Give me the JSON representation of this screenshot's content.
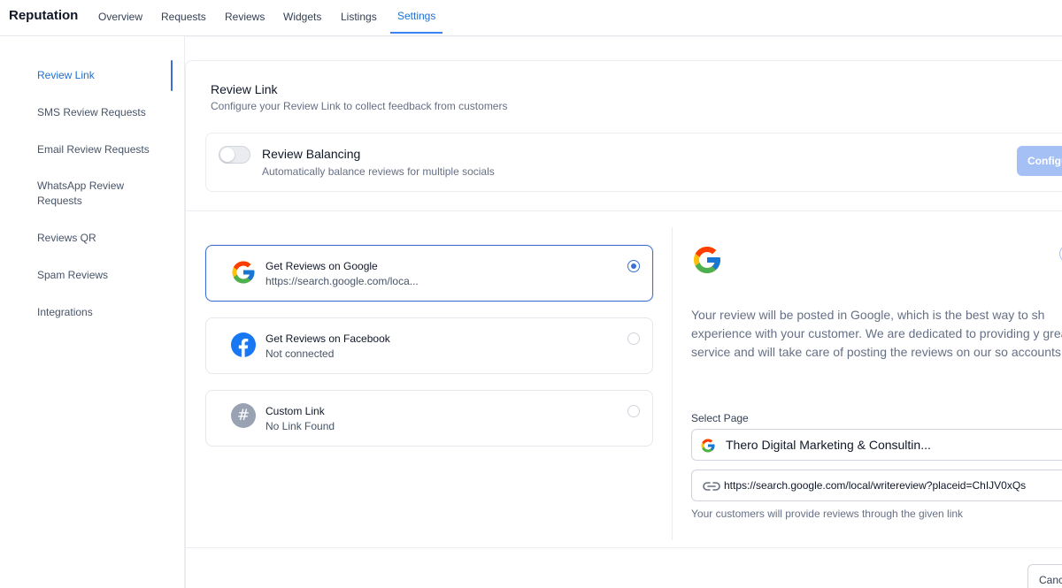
{
  "nav": {
    "brand": "Reputation",
    "tabs": [
      {
        "label": "Overview"
      },
      {
        "label": "Requests"
      },
      {
        "label": "Reviews"
      },
      {
        "label": "Widgets"
      },
      {
        "label": "Listings"
      },
      {
        "label": "Settings",
        "active": true
      }
    ]
  },
  "sidebar": {
    "items": [
      {
        "label": "Review Link",
        "active": true
      },
      {
        "label": "SMS Review Requests"
      },
      {
        "label": "Email Review Requests"
      },
      {
        "label": "WhatsApp Review Requests"
      },
      {
        "label": "Reviews QR"
      },
      {
        "label": "Spam Reviews"
      },
      {
        "label": "Integrations"
      }
    ]
  },
  "card": {
    "title": "Review Link",
    "subtitle": "Configure your Review Link to collect feedback from customers",
    "balancing": {
      "title": "Review Balancing",
      "subtitle": "Automatically balance reviews for multiple socials",
      "enabled": false,
      "configure_label": "Configu"
    },
    "options": [
      {
        "title": "Get Reviews on Google",
        "subtitle": "https://search.google.com/loca...",
        "icon": "google-icon",
        "selected": true
      },
      {
        "title": "Get Reviews on Facebook",
        "subtitle": "Not connected",
        "icon": "facebook-icon",
        "selected": false
      },
      {
        "title": "Custom Link",
        "subtitle": "No Link Found",
        "icon": "hash-icon",
        "selected": false
      }
    ],
    "detail": {
      "description": "Your review will be posted in Google, which is the best way to sh experience with your customer. We are dedicated to providing y great service and will take care of posting the reviews on our so accounts.",
      "select_label": "Select Page",
      "selected_page": "Thero Digital Marketing & Consultin...",
      "link": "https://search.google.com/local/writereview?placeid=ChIJV0xQs",
      "helper": "Your customers will provide reviews through the given link"
    },
    "cancel_label": "Canc"
  },
  "colors": {
    "accent": "#3b6fd4",
    "configure_bg": "#a5c0f5",
    "facebook": "#1877f2"
  }
}
